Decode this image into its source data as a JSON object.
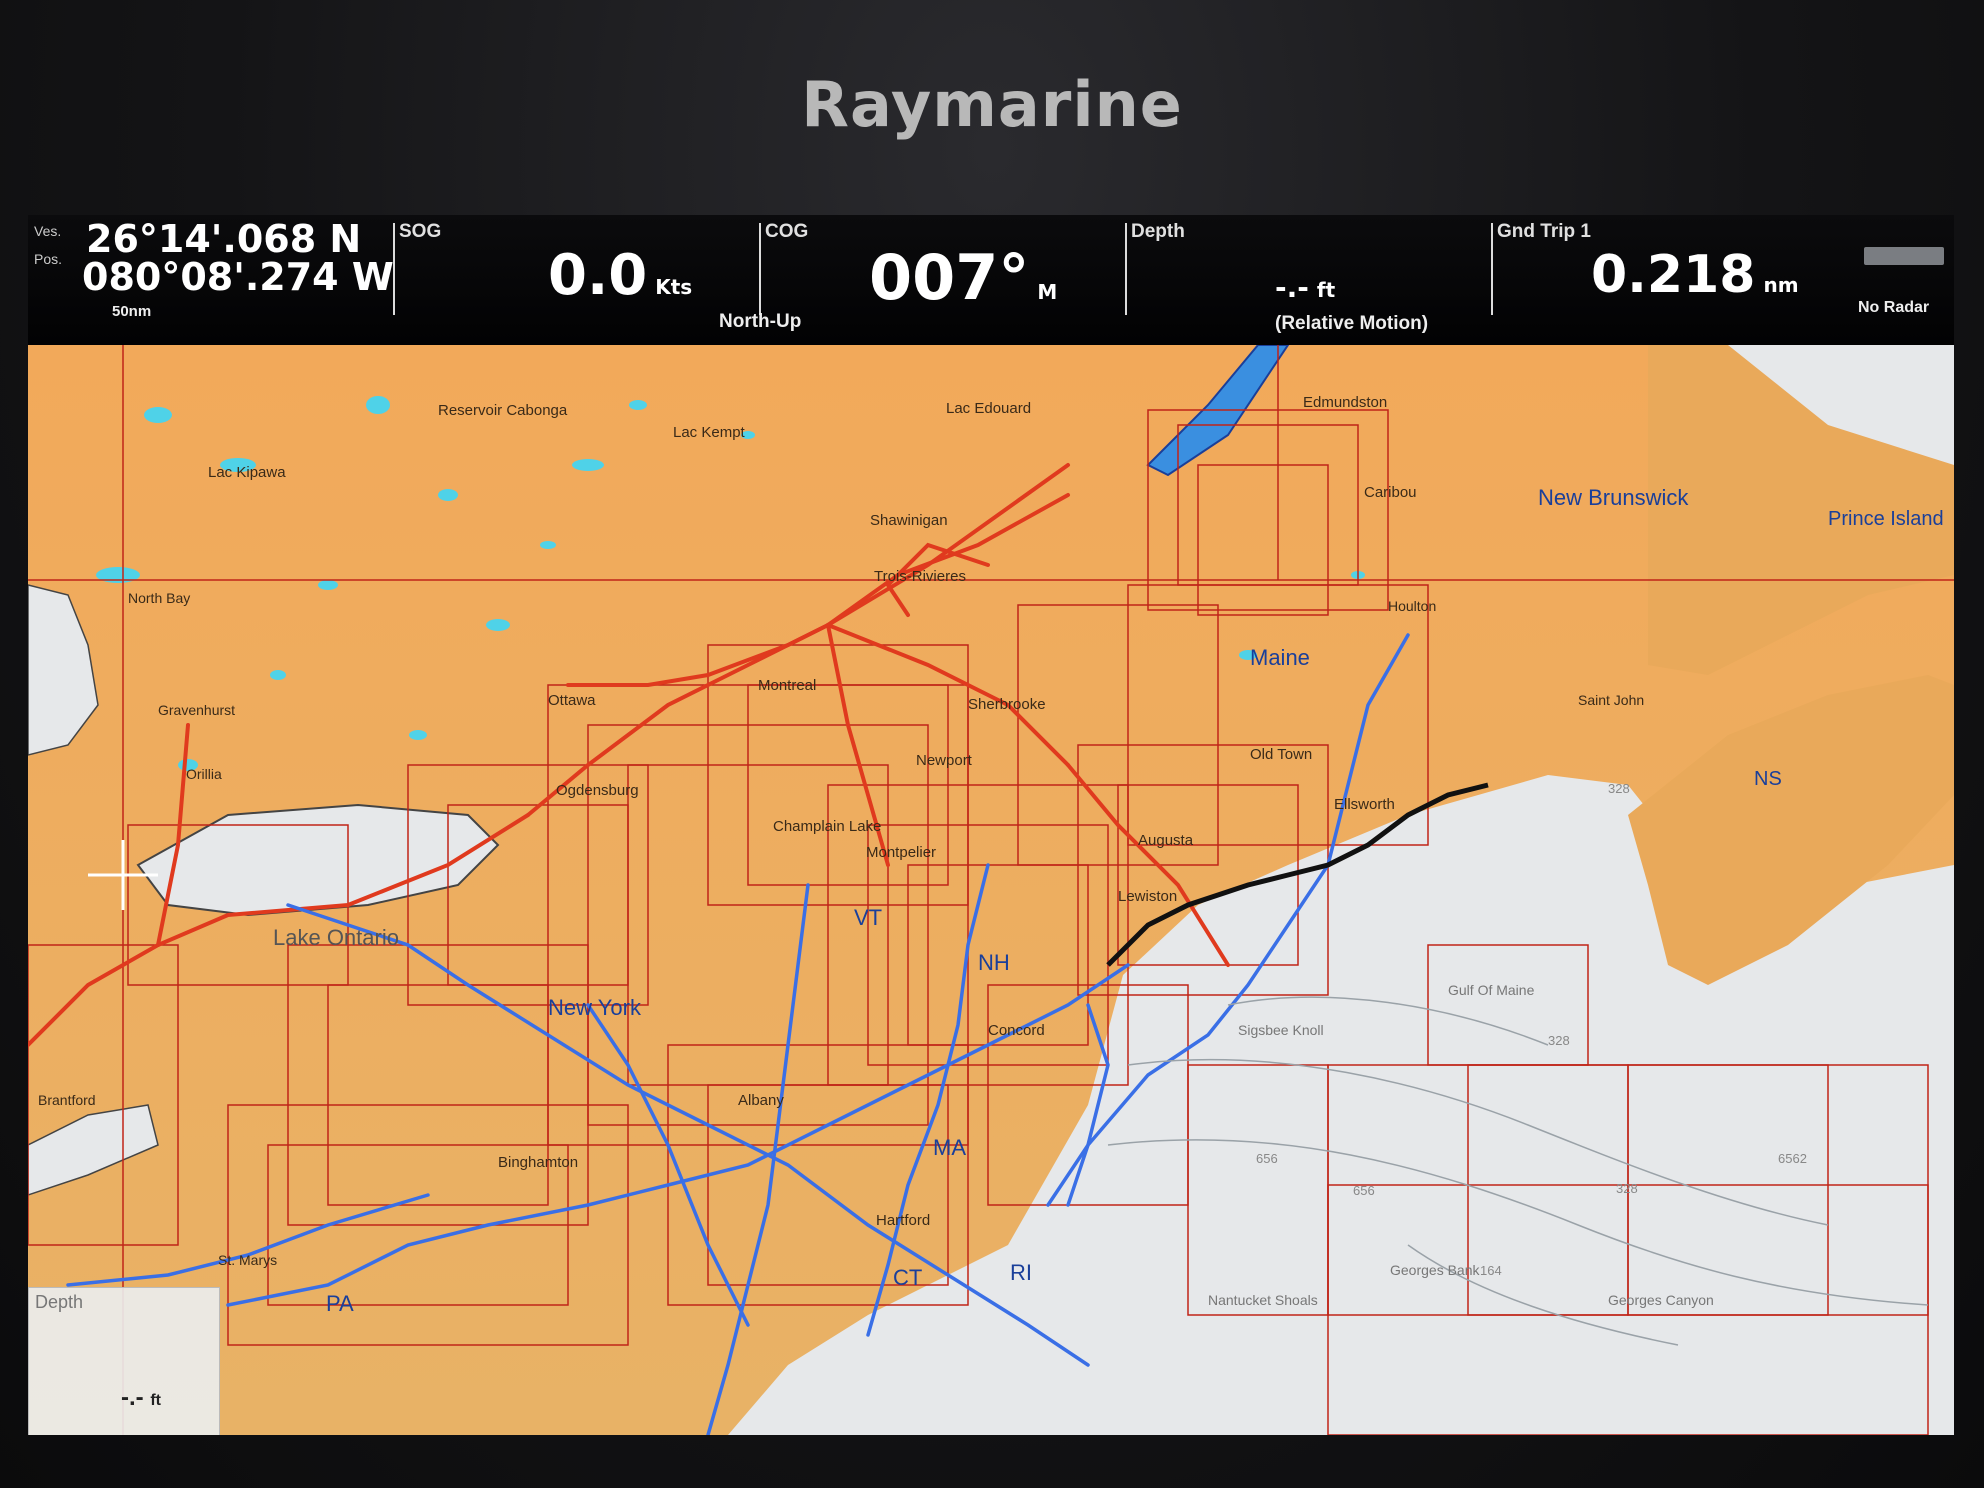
{
  "device": {
    "brand": "Raymarine"
  },
  "databar": {
    "position": {
      "label_top": "Ves.",
      "label_bottom": "Pos.",
      "lat": "26°14'.068 N",
      "lon": "080°08'.274 W",
      "scale": "50nm"
    },
    "sog": {
      "label": "SOG",
      "value": "0.0",
      "unit": "Kts"
    },
    "cog": {
      "label": "COG",
      "value": "007°",
      "unit": "M",
      "mode": "North-Up"
    },
    "depth": {
      "label": "Depth",
      "value": "-.-",
      "unit": "ft",
      "motion": "(Relative Motion)"
    },
    "trip": {
      "label": "Gnd Trip 1",
      "value": "0.218",
      "unit": "nm"
    },
    "radar": {
      "label": "No Radar"
    }
  },
  "depth_widget": {
    "label": "Depth",
    "value": "-.-",
    "unit": "ft"
  },
  "map_labels": {
    "reservoir_cabonga": "Reservoir Cabonga",
    "lac_kempt": "Lac Kempt",
    "lac_edouard": "Lac Edouard",
    "lac_kipawa": "Lac Kipawa",
    "edmundston": "Edmundston",
    "caribou": "Caribou",
    "new_brunswick": "New Brunswick",
    "prince_edward_island": "Prince Island",
    "shawinigan": "Shawinigan",
    "trois_rivieres": "Trois-Rivieres",
    "north_bay": "North Bay",
    "houlton": "Houlton",
    "maine": "Maine",
    "montreal": "Montreal",
    "ottawa": "Ottawa",
    "sherbrooke": "Sherbrooke",
    "gravenhurst": "Gravenhurst",
    "saint_john": "Saint John",
    "newport": "Newport",
    "old_town": "Old Town",
    "ogdensburg": "Ogdensburg",
    "orillia": "Orillia",
    "ns": "NS",
    "ellsworth": "Ellsworth",
    "champlain": "Champlain Lake",
    "montpelier": "Montpelier",
    "augusta": "Augusta",
    "vt": "VT",
    "lewiston": "Lewiston",
    "lake_ontario": "Lake Ontario",
    "nh": "NH",
    "new_york": "New York",
    "gulf_of_maine": "Gulf Of Maine",
    "concord": "Concord",
    "sigsbee_knoll": "Sigsbee Knoll",
    "albany": "Albany",
    "ma": "MA",
    "binghamton": "Binghamton",
    "hartford": "Hartford",
    "st_marys": "St. Marys",
    "ct": "CT",
    "ri": "RI",
    "pa": "PA",
    "nantucket_shoals": "Nantucket Shoals",
    "georges_bank": "Georges Bank",
    "georges_canyon": "Georges Canyon",
    "brantford": "Brantford",
    "depth_656a": "656",
    "depth_656b": "656",
    "depth_6562": "6562",
    "depth_328a": "328",
    "depth_328b": "328",
    "depth_328c": "328",
    "depth_164": "164"
  },
  "colors": {
    "land": "#e9a95a",
    "water": "#4fd2e8",
    "deep_sea": "#e6e8ea",
    "chart_grid": "#c02418",
    "roads": "#e03a1e",
    "highways": "#3a6fe6"
  }
}
